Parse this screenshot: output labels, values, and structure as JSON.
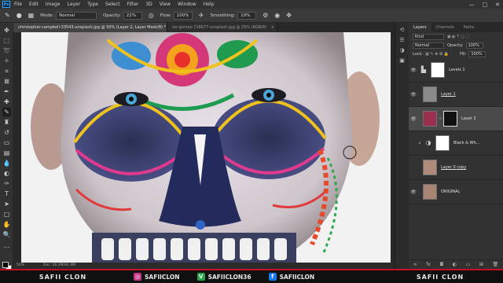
{
  "menu": [
    "File",
    "Edit",
    "Image",
    "Layer",
    "Type",
    "Select",
    "Filter",
    "3D",
    "View",
    "Window",
    "Help"
  ],
  "app_icon": "Ps",
  "window_controls": [
    "—",
    "□",
    "✕"
  ],
  "options": {
    "mode_label": "Mode:",
    "mode_value": "Normal",
    "opacity_label": "Opacity:",
    "opacity_value": "22%",
    "flow_label": "Flow:",
    "flow_value": "100%",
    "smoothing_label": "Smoothing:",
    "smoothing_value": "10%"
  },
  "tabs": [
    {
      "label": "christopher-campbell-33543-unsplash.jpg @ 50% (Layer 2, Layer Mask/8) *",
      "close": "×"
    },
    {
      "label": "ter-gomez-718677-unsplash.jpg @ 25% (RGB/8)",
      "close": "×"
    }
  ],
  "status": {
    "zoom": "50%",
    "doc": "Doc: 26.2M/82.4M"
  },
  "layers_panel": {
    "tabs": [
      "Layers",
      "Channels",
      "Paths"
    ],
    "kind_label": "Kind",
    "blend_mode": "Normal",
    "opacity_label": "Opacity:",
    "opacity_value": "100%",
    "lock_label": "Lock:",
    "fill_label": "Fill:",
    "fill_value": "100%",
    "layers": [
      {
        "name": "Levels 1",
        "visible": true,
        "selected": false
      },
      {
        "name": "Layer 1",
        "visible": true,
        "selected": false
      },
      {
        "name": "Layer 2",
        "visible": true,
        "selected": true
      },
      {
        "name": "Black & Wh...",
        "visible": false,
        "selected": false
      },
      {
        "name": "Layer 0 copy",
        "visible": false,
        "selected": false
      },
      {
        "name": "ORIGINAL",
        "visible": true,
        "selected": false
      }
    ]
  },
  "banner": {
    "left_brand": "SAFII CLON",
    "instagram": "SAFIICLON",
    "vine": "SAFIICLON36",
    "facebook": "SAFIICLON",
    "right_brand": "SAFII CLON"
  },
  "colors": {
    "accent": "#c41022",
    "selection": "#4a4a4a"
  }
}
